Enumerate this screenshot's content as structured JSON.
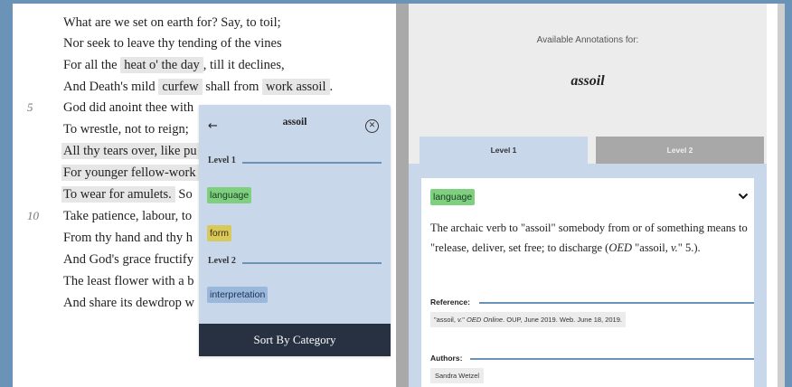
{
  "poem": {
    "lines": [
      {
        "segments": [
          "What are we set on earth for? Say, to toil;"
        ]
      },
      {
        "segments": [
          "Nor seek to leave thy tending of the vines"
        ]
      },
      {
        "segments": [
          "For all the",
          "heat o' the day",
          ", till it declines,"
        ]
      },
      {
        "segments": [
          "And Death's mild",
          "curfew",
          "shall from",
          "work assoil",
          "."
        ]
      },
      {
        "number": "5",
        "segments": [
          "God did anoint thee with"
        ]
      },
      {
        "segments": [
          "To wrestle, not to reign;"
        ]
      },
      {
        "segments": [
          "All thy tears over, like pu"
        ]
      },
      {
        "segments": [
          "For younger fellow-work"
        ]
      },
      {
        "segments": [
          "To wear for amulets.",
          "So"
        ]
      },
      {
        "number": "10",
        "segments": [
          "Take patience, labour, to"
        ]
      },
      {
        "segments": [
          "From thy hand and thy h"
        ]
      },
      {
        "segments": [
          "And God's grace fructify"
        ]
      },
      {
        "segments": [
          "The least flower with a b"
        ]
      },
      {
        "segments": [
          "And share its dewdrop w"
        ]
      }
    ]
  },
  "popup": {
    "title": "assoil",
    "back_icon": "←",
    "close_icon": "⊗",
    "level1_label": "Level 1",
    "level2_label": "Level 2",
    "chips": {
      "language": "language",
      "form": "form",
      "interpretation": "interpretation"
    },
    "sort_label": "Sort By Category"
  },
  "panel": {
    "available_label": "Available Annotations for:",
    "term": "assoil",
    "tabs": [
      "Level 1",
      "Level 2"
    ],
    "card": {
      "chip": "language",
      "text_before": "The archaic verb to \"assoil\" somebody from or of something means to \"release, deliver, set free; to discharge (",
      "text_oed": "OED",
      "text_middle": " \"assoil, ",
      "text_v": "v.",
      "text_after": "\" 5.).",
      "reference_label": "Reference:",
      "reference_before": "\"assoil, ",
      "reference_v": "v.",
      "reference_mid": "\" ",
      "reference_oed": "OED Online",
      "reference_after": ". OUP, June 2019. Web. June 18, 2019.",
      "authors_label": "Authors:",
      "author": "Sandra Wetzel"
    }
  },
  "colors": {
    "frame_blue": "#6b93b8",
    "popup_bg": "#c9d7ea",
    "chip_language": "#7ed07f",
    "chip_form": "#d8c95a",
    "chip_interpretation": "#9ab8dc",
    "sort_button": "#283142"
  }
}
